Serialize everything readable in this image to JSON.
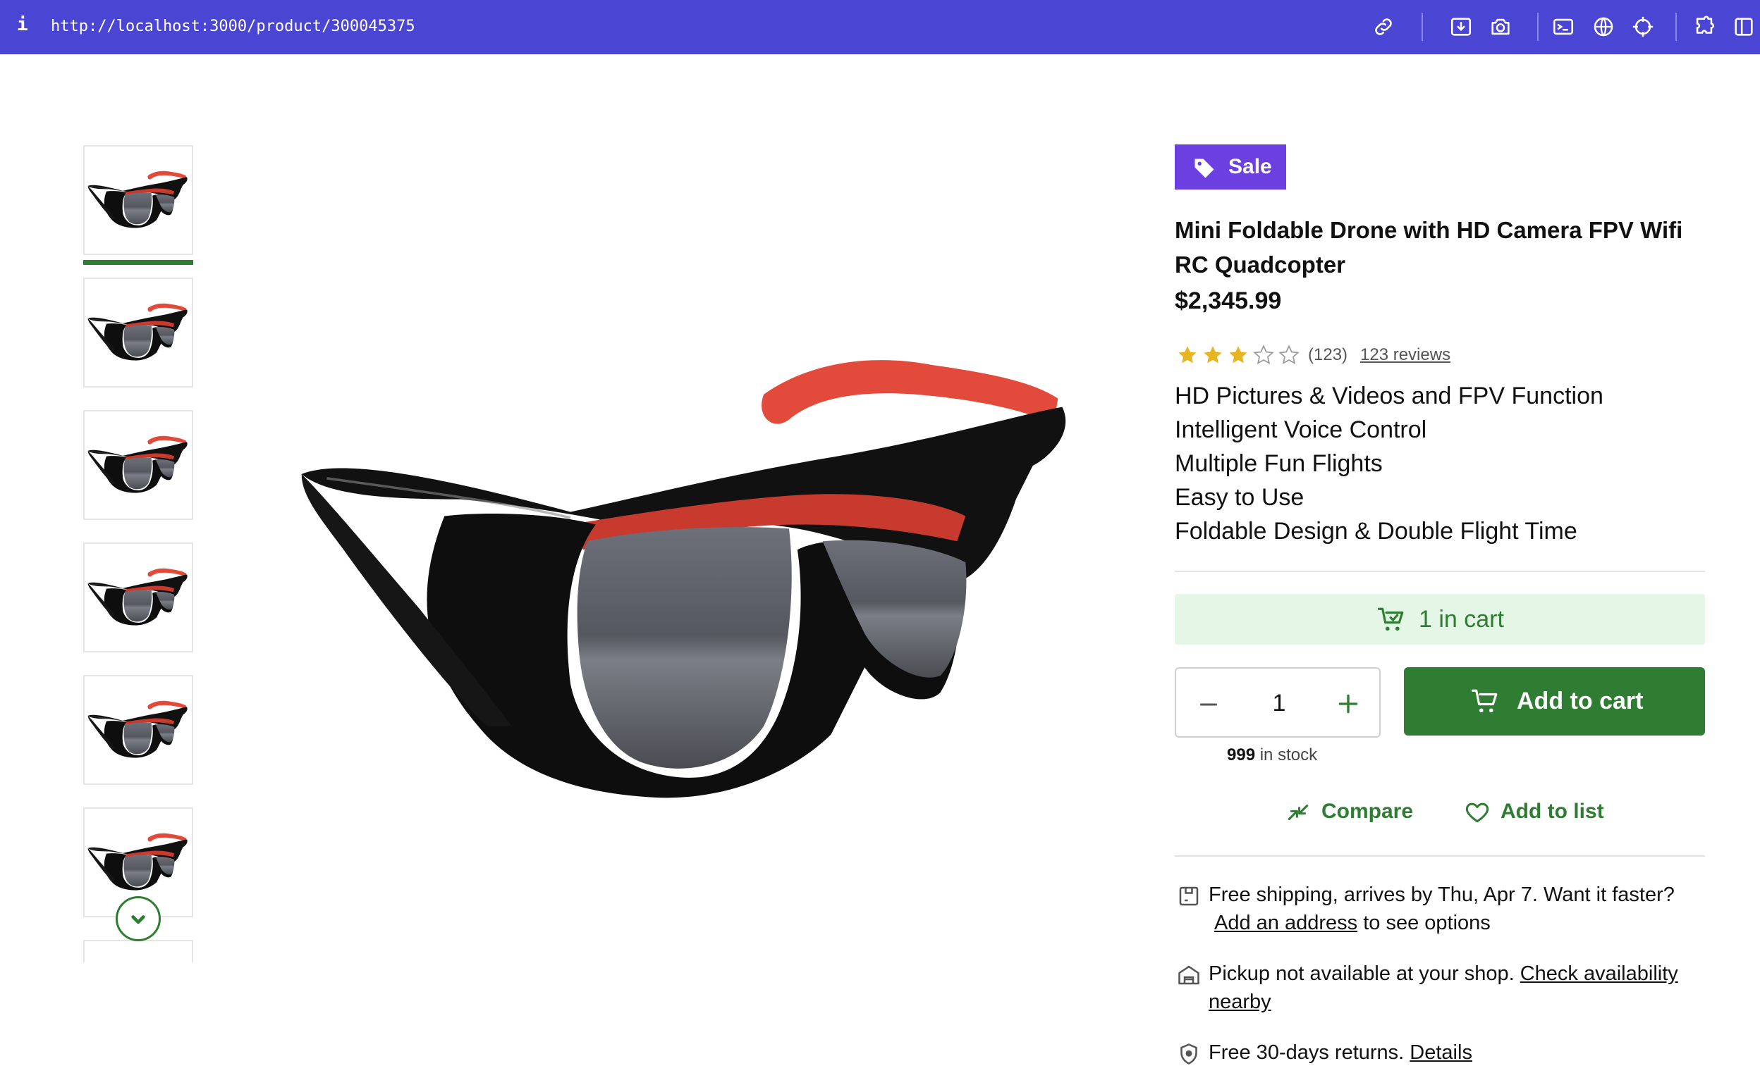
{
  "browser": {
    "info_glyph": "i",
    "url": "http://localhost:3000/product/300045375",
    "toolbar_icons": [
      "link-icon",
      "download-icon",
      "camera-icon",
      "terminal-icon",
      "globe-icon",
      "crosshair-icon",
      "extension-icon",
      "sidebar-icon"
    ]
  },
  "gallery": {
    "thumbnail_count": 7,
    "selected_index": 0,
    "scroll_icon": "chevron-down-icon"
  },
  "product": {
    "badge": "Sale",
    "title": "Mini Foldable Drone with HD Camera FPV Wifi RC Quadcopter",
    "price": "$2,345.99",
    "rating": 3,
    "rating_max": 5,
    "rating_count": "(123)",
    "reviews_link": "123 reviews",
    "features": [
      "HD Pictures & Videos and FPV Function",
      "Intelligent Voice Control",
      "Multiple Fun Flights",
      "Easy to Use",
      "Foldable Design & Double Flight Time"
    ]
  },
  "cart": {
    "in_cart_label": "1 in cart",
    "quantity": "1",
    "add_button": "Add to cart",
    "stock_count": "999",
    "stock_suffix": "in stock"
  },
  "actions": {
    "compare": "Compare",
    "add_to_list": "Add to list"
  },
  "delivery": {
    "shipping_text": "Free shipping, arrives by Thu, Apr 7. Want it faster?",
    "shipping_link": "Add an address",
    "shipping_suffix": "to see options",
    "pickup_text": "Pickup not available at your shop.",
    "pickup_link": "Check availability nearby",
    "returns_text": "Free 30-days returns.",
    "returns_link": "Details"
  },
  "colors": {
    "topbar": "#4a46d3",
    "brand_green": "#2f7d32",
    "sale_purple": "#6b3fe0",
    "in_cart_bg": "#e4f6e6",
    "star_fill": "#e8b420"
  }
}
